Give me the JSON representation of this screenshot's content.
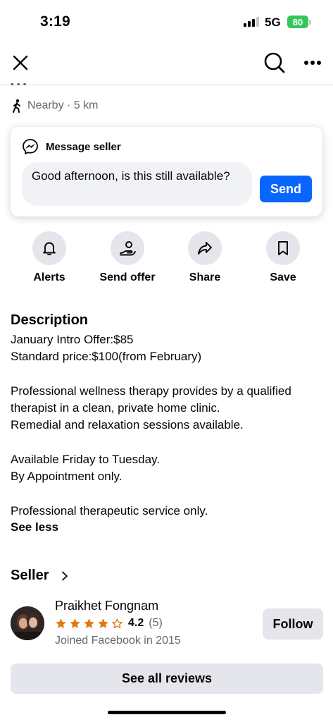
{
  "status_bar": {
    "time": "3:19",
    "network": "5G",
    "battery": "80"
  },
  "nav": {
    "close_icon": "close-icon",
    "search_icon": "search-icon",
    "more_icon": "more-icon"
  },
  "partial_line": "• • •",
  "location": {
    "icon": "walk-icon",
    "text": "Nearby · 5 km"
  },
  "message_card": {
    "title": "Message seller",
    "input_value": "Good afternoon, is this still available?",
    "send_label": "Send"
  },
  "actions": [
    {
      "label": "Alerts",
      "icon": "bell-icon"
    },
    {
      "label": "Send offer",
      "icon": "offer-icon"
    },
    {
      "label": "Share",
      "icon": "share-icon"
    },
    {
      "label": "Save",
      "icon": "bookmark-icon"
    }
  ],
  "description": {
    "title": "Description",
    "lines": [
      "January Intro Offer:$85",
      "Standard price:$100(from February)",
      "",
      "Professional wellness therapy provides by a qualified",
      "therapist in a clean, private home clinic.",
      "Remedial and relaxation sessions available.",
      "",
      "Available Friday to Tuesday.",
      "By Appointment only.",
      "",
      "Professional therapeutic service only."
    ],
    "see_less": "See less"
  },
  "seller": {
    "title": "Seller",
    "name": "Praikhet Fongnam",
    "rating": "4.2",
    "rating_count": "(5)",
    "rating_value": 4.2,
    "joined": "Joined Facebook in 2015",
    "follow_label": "Follow"
  },
  "reviews_button": "See all reviews",
  "colors": {
    "accent": "#0866ff",
    "star": "#e07a10",
    "muted": "#65676b",
    "button_bg": "#e4e6eb",
    "battery": "#34c759"
  }
}
